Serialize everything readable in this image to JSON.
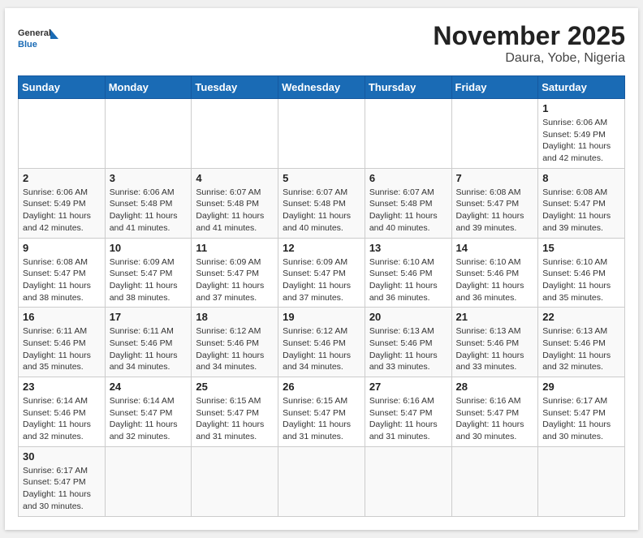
{
  "header": {
    "logo_general": "General",
    "logo_blue": "Blue",
    "title": "November 2025",
    "subtitle": "Daura, Yobe, Nigeria"
  },
  "weekdays": [
    "Sunday",
    "Monday",
    "Tuesday",
    "Wednesday",
    "Thursday",
    "Friday",
    "Saturday"
  ],
  "weeks": [
    [
      {
        "day": "",
        "info": ""
      },
      {
        "day": "",
        "info": ""
      },
      {
        "day": "",
        "info": ""
      },
      {
        "day": "",
        "info": ""
      },
      {
        "day": "",
        "info": ""
      },
      {
        "day": "",
        "info": ""
      },
      {
        "day": "1",
        "info": "Sunrise: 6:06 AM\nSunset: 5:49 PM\nDaylight: 11 hours and 42 minutes."
      }
    ],
    [
      {
        "day": "2",
        "info": "Sunrise: 6:06 AM\nSunset: 5:49 PM\nDaylight: 11 hours and 42 minutes."
      },
      {
        "day": "3",
        "info": "Sunrise: 6:06 AM\nSunset: 5:48 PM\nDaylight: 11 hours and 41 minutes."
      },
      {
        "day": "4",
        "info": "Sunrise: 6:07 AM\nSunset: 5:48 PM\nDaylight: 11 hours and 41 minutes."
      },
      {
        "day": "5",
        "info": "Sunrise: 6:07 AM\nSunset: 5:48 PM\nDaylight: 11 hours and 40 minutes."
      },
      {
        "day": "6",
        "info": "Sunrise: 6:07 AM\nSunset: 5:48 PM\nDaylight: 11 hours and 40 minutes."
      },
      {
        "day": "7",
        "info": "Sunrise: 6:08 AM\nSunset: 5:47 PM\nDaylight: 11 hours and 39 minutes."
      },
      {
        "day": "8",
        "info": "Sunrise: 6:08 AM\nSunset: 5:47 PM\nDaylight: 11 hours and 39 minutes."
      }
    ],
    [
      {
        "day": "9",
        "info": "Sunrise: 6:08 AM\nSunset: 5:47 PM\nDaylight: 11 hours and 38 minutes."
      },
      {
        "day": "10",
        "info": "Sunrise: 6:09 AM\nSunset: 5:47 PM\nDaylight: 11 hours and 38 minutes."
      },
      {
        "day": "11",
        "info": "Sunrise: 6:09 AM\nSunset: 5:47 PM\nDaylight: 11 hours and 37 minutes."
      },
      {
        "day": "12",
        "info": "Sunrise: 6:09 AM\nSunset: 5:47 PM\nDaylight: 11 hours and 37 minutes."
      },
      {
        "day": "13",
        "info": "Sunrise: 6:10 AM\nSunset: 5:46 PM\nDaylight: 11 hours and 36 minutes."
      },
      {
        "day": "14",
        "info": "Sunrise: 6:10 AM\nSunset: 5:46 PM\nDaylight: 11 hours and 36 minutes."
      },
      {
        "day": "15",
        "info": "Sunrise: 6:10 AM\nSunset: 5:46 PM\nDaylight: 11 hours and 35 minutes."
      }
    ],
    [
      {
        "day": "16",
        "info": "Sunrise: 6:11 AM\nSunset: 5:46 PM\nDaylight: 11 hours and 35 minutes."
      },
      {
        "day": "17",
        "info": "Sunrise: 6:11 AM\nSunset: 5:46 PM\nDaylight: 11 hours and 34 minutes."
      },
      {
        "day": "18",
        "info": "Sunrise: 6:12 AM\nSunset: 5:46 PM\nDaylight: 11 hours and 34 minutes."
      },
      {
        "day": "19",
        "info": "Sunrise: 6:12 AM\nSunset: 5:46 PM\nDaylight: 11 hours and 34 minutes."
      },
      {
        "day": "20",
        "info": "Sunrise: 6:13 AM\nSunset: 5:46 PM\nDaylight: 11 hours and 33 minutes."
      },
      {
        "day": "21",
        "info": "Sunrise: 6:13 AM\nSunset: 5:46 PM\nDaylight: 11 hours and 33 minutes."
      },
      {
        "day": "22",
        "info": "Sunrise: 6:13 AM\nSunset: 5:46 PM\nDaylight: 11 hours and 32 minutes."
      }
    ],
    [
      {
        "day": "23",
        "info": "Sunrise: 6:14 AM\nSunset: 5:46 PM\nDaylight: 11 hours and 32 minutes."
      },
      {
        "day": "24",
        "info": "Sunrise: 6:14 AM\nSunset: 5:47 PM\nDaylight: 11 hours and 32 minutes."
      },
      {
        "day": "25",
        "info": "Sunrise: 6:15 AM\nSunset: 5:47 PM\nDaylight: 11 hours and 31 minutes."
      },
      {
        "day": "26",
        "info": "Sunrise: 6:15 AM\nSunset: 5:47 PM\nDaylight: 11 hours and 31 minutes."
      },
      {
        "day": "27",
        "info": "Sunrise: 6:16 AM\nSunset: 5:47 PM\nDaylight: 11 hours and 31 minutes."
      },
      {
        "day": "28",
        "info": "Sunrise: 6:16 AM\nSunset: 5:47 PM\nDaylight: 11 hours and 30 minutes."
      },
      {
        "day": "29",
        "info": "Sunrise: 6:17 AM\nSunset: 5:47 PM\nDaylight: 11 hours and 30 minutes."
      }
    ],
    [
      {
        "day": "30",
        "info": "Sunrise: 6:17 AM\nSunset: 5:47 PM\nDaylight: 11 hours and 30 minutes."
      },
      {
        "day": "",
        "info": ""
      },
      {
        "day": "",
        "info": ""
      },
      {
        "day": "",
        "info": ""
      },
      {
        "day": "",
        "info": ""
      },
      {
        "day": "",
        "info": ""
      },
      {
        "day": "",
        "info": ""
      }
    ]
  ]
}
